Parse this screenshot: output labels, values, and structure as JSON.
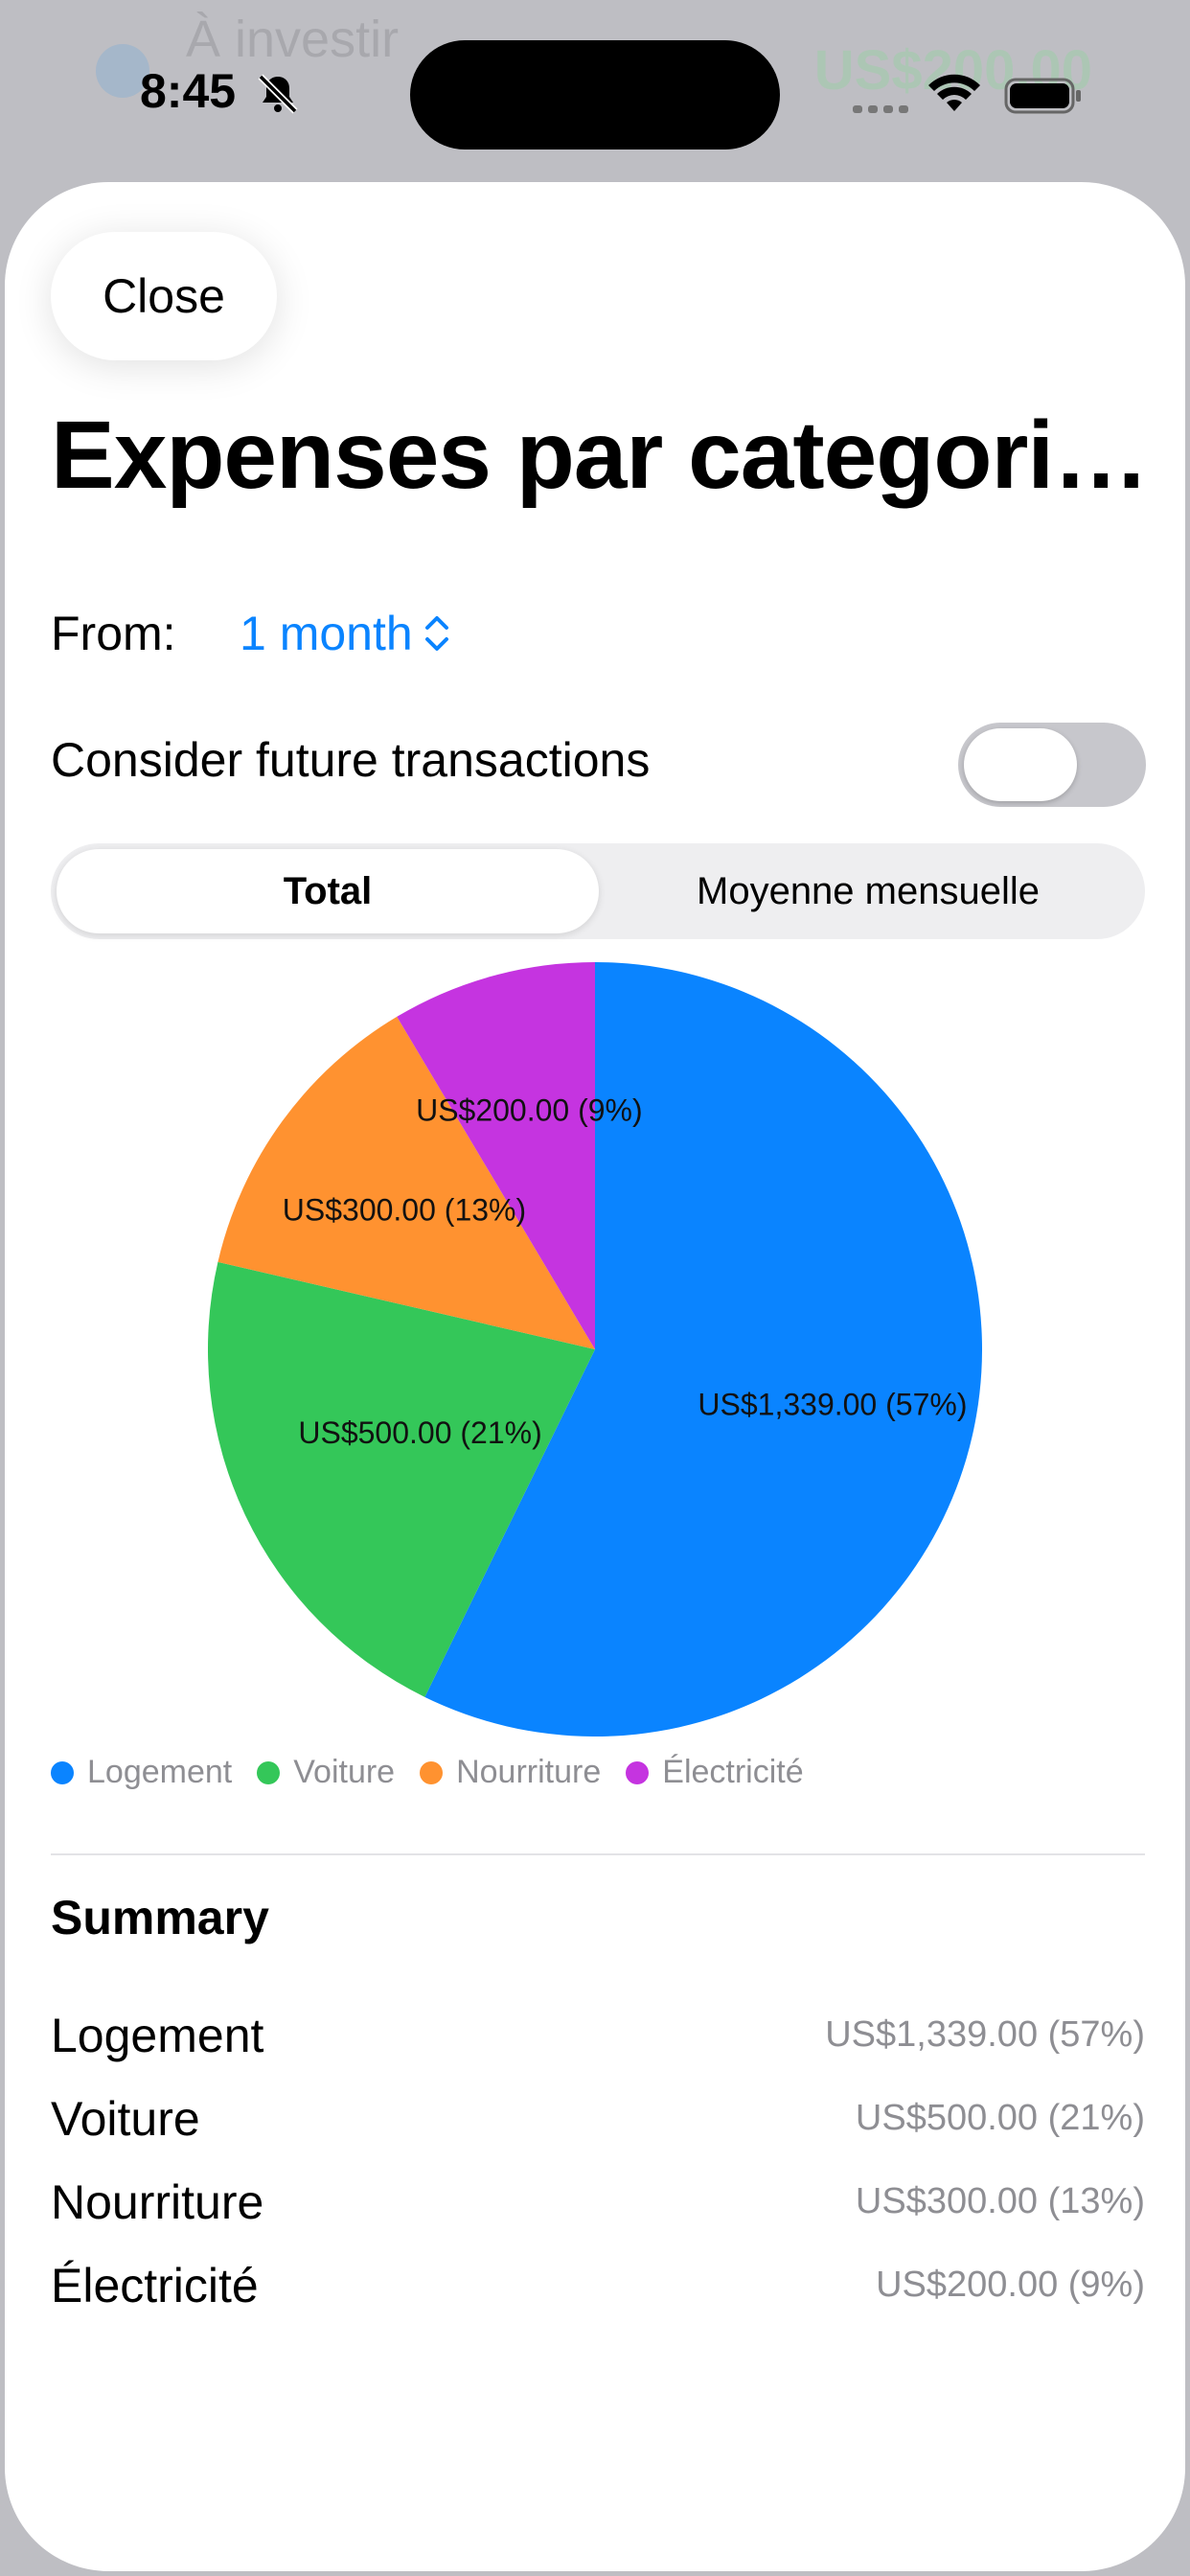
{
  "background": {
    "title": "À investir",
    "amount": "US$200.00"
  },
  "status_bar": {
    "time": "8:45"
  },
  "sheet": {
    "close_label": "Close",
    "title": "Expenses par categori…",
    "from_label": "From:",
    "period_value": "1 month",
    "future_label": "Consider future transactions",
    "future_enabled": false,
    "segments": [
      "Total",
      "Moyenne mensuelle"
    ],
    "selected_segment": "Total",
    "summary_title": "Summary",
    "summary": [
      {
        "name": "Logement",
        "value": "US$1,339.00 (57%)"
      },
      {
        "name": "Voiture",
        "value": "US$500.00 (21%)"
      },
      {
        "name": "Nourriture",
        "value": "US$300.00 (13%)"
      },
      {
        "name": "Électricité",
        "value": "US$200.00 (9%)"
      }
    ]
  },
  "chart_data": {
    "type": "pie",
    "categories": [
      "Logement",
      "Voiture",
      "Nourriture",
      "Électricité"
    ],
    "values": [
      1339,
      500,
      300,
      200
    ],
    "labels": [
      "US$1,339.00 (57%)",
      "US$500.00 (21%)",
      "US$300.00 (13%)",
      "US$200.00 (9%)"
    ],
    "colors": [
      "#0a84ff",
      "#34c759",
      "#ff9230",
      "#c534e0"
    ],
    "legend": "bottom-left"
  }
}
